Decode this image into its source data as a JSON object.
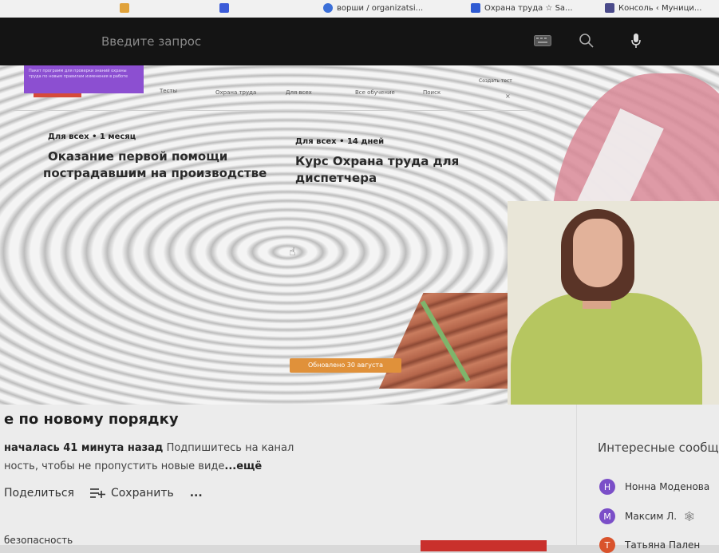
{
  "bookmarks": [
    {
      "label": "ворши / organizatsi...",
      "icon": "globe-icon",
      "color": "#3b6fd8"
    },
    {
      "label": "Охрана труда ☆ Sa...",
      "icon": "bookmark-icon",
      "color": "#2f5bd3"
    },
    {
      "label": "Консоль ‹ Муници...",
      "icon": "chart-icon",
      "color": "#4a4a8a"
    }
  ],
  "search": {
    "placeholder": "Введите запрос"
  },
  "overlay": {
    "promo_text": "Пакет программ для проверки знаний охраны труда по новым правилам изменения в работе",
    "filters": [
      "Тесты",
      "Охрана труда",
      "Для всех",
      "Все обучение",
      "Поиск"
    ],
    "create_test": "Создать тест",
    "close": "×"
  },
  "courses": [
    {
      "meta": "Для всех • 1 месяц",
      "title_line1": "Оказание первой помощи",
      "title_line2": "пострадавшим на производстве"
    },
    {
      "meta": "Для всех • 14 дней",
      "title_line1": "Курс Охрана труда для",
      "title_line2": "диспетчера"
    }
  ],
  "updated_badge": "Обновлено 30 августа",
  "video": {
    "title": "е по новому порядку",
    "desc_bold": "началась 41 минута назад",
    "desc_rest": "Подпишитесь на канал",
    "desc_line2": "ность, чтобы не пропустить новые виде",
    "more": "...ещё",
    "share": "Поделиться",
    "save": "Сохранить",
    "more_actions": "...",
    "tag": "безопасность"
  },
  "side": {
    "title": "Интересные сообщ",
    "comments": [
      {
        "initial": "Н",
        "name": "Нонна Моденова",
        "color": "#7b4fc8"
      },
      {
        "initial": "М",
        "name": "Максим Л.",
        "color": "#7b4fc8"
      },
      {
        "initial": "Т",
        "name": "Татьяна Пален",
        "color": "#d9532c"
      }
    ]
  }
}
